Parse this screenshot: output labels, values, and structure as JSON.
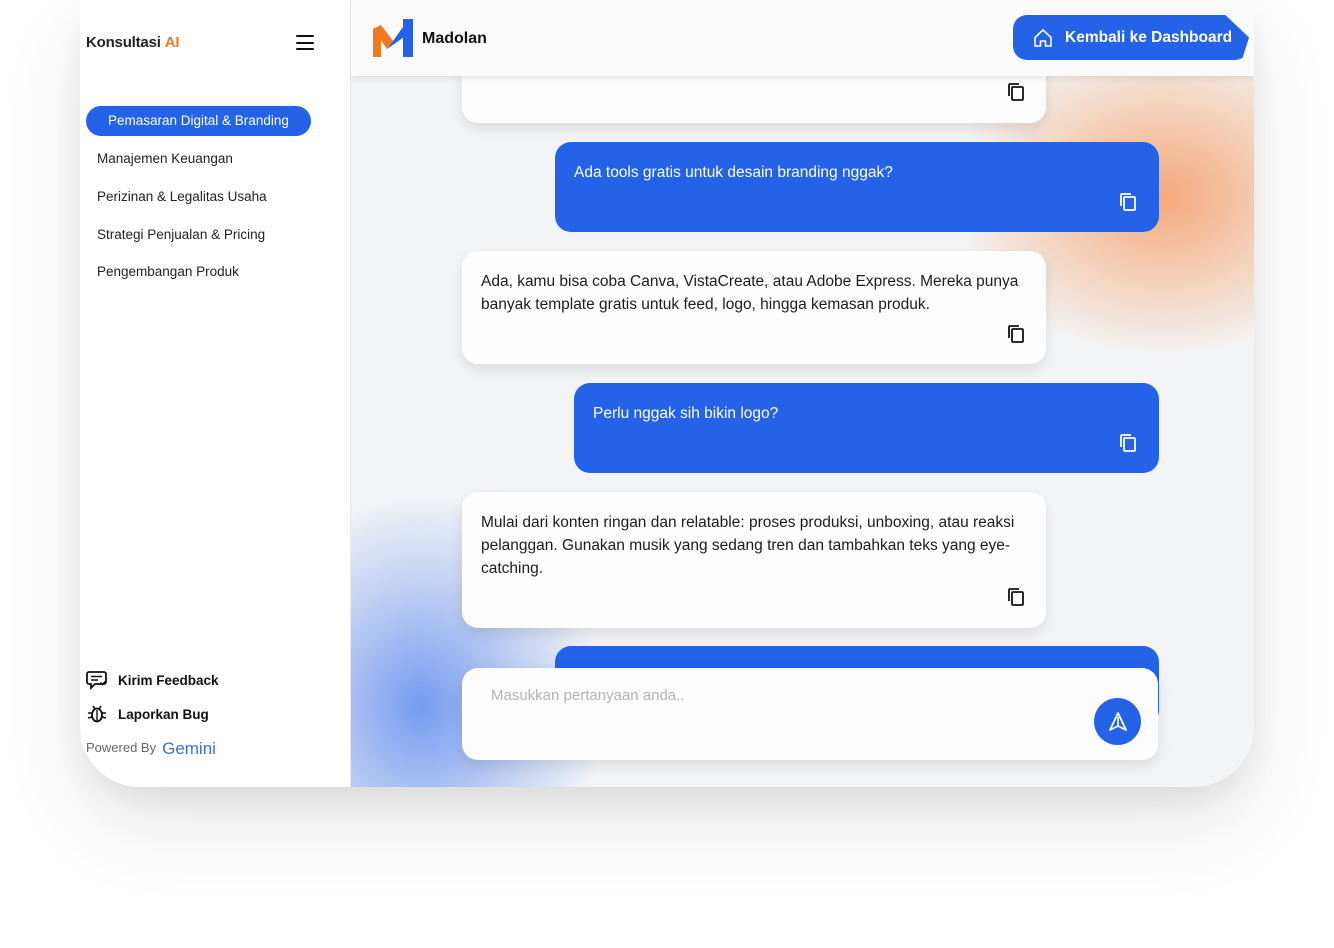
{
  "sidebar": {
    "brand": "Konsultasi",
    "brand_ai": "AI",
    "items": [
      {
        "label": "Pemasaran Digital & Branding",
        "active": true
      },
      {
        "label": "Manajemen Keuangan"
      },
      {
        "label": "Perizinan & Legalitas Usaha"
      },
      {
        "label": "Strategi Penjualan & Pricing"
      },
      {
        "label": "Pengembangan Produk"
      }
    ],
    "feedback_label": "Kirim Feedback",
    "bug_label": "Laporkan Bug",
    "powered_by": "Powered By",
    "powered_brand": "Gemini"
  },
  "header": {
    "app_name": "Madolan",
    "dashboard_button": "Kembali ke Dashboard"
  },
  "chat": {
    "messages": [
      {
        "role": "ai",
        "text": ""
      },
      {
        "role": "user",
        "text": "Ada tools gratis untuk desain branding nggak?"
      },
      {
        "role": "ai",
        "text": "Ada, kamu bisa coba Canva, VistaCreate, atau Adobe Express. Mereka punya banyak template gratis untuk feed, logo, hingga kemasan produk."
      },
      {
        "role": "user",
        "text": "Perlu nggak sih bikin logo?"
      },
      {
        "role": "ai",
        "text": "Mulai dari konten ringan dan relatable: proses produksi, unboxing, atau reaksi pelanggan. Gunakan musik yang sedang tren dan tambahkan teks yang eye-catching."
      },
      {
        "role": "user",
        "text": ""
      }
    ],
    "input_placeholder": "Masukkan pertanyaan anda.."
  },
  "colors": {
    "primary": "#2463e8",
    "accent": "#f07a22"
  },
  "icons": {
    "menu": "hamburger-icon",
    "home": "home-icon",
    "copy": "copy-icon",
    "feedback": "feedback-icon",
    "bug": "bug-icon",
    "send": "send-icon"
  }
}
